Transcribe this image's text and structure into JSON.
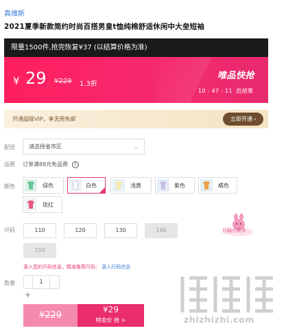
{
  "store_name": "真维斯",
  "product_title": "2021夏季新款简约时尚百搭男皇t恤纯棉舒适休闲中大垒短袖",
  "promo": {
    "limit_text": "限量1500件,抢完恢复¥37 (以结算价格为准)",
    "currency": "¥",
    "price": "29",
    "original_price": "¥229",
    "discount": "1.3折",
    "flash_label": "唯品快抢",
    "countdown_h": "10",
    "countdown_m": "47",
    "countdown_s": "11",
    "countdown_suffix": "后结束"
  },
  "vip": {
    "text": "开通超级VIP，享无限免邮",
    "button": "立即开通"
  },
  "delivery": {
    "label": "配送",
    "region_placeholder": "请选择省市区"
  },
  "shipping": {
    "label": "运费",
    "text": "订单满88元免运费",
    "help_icon": "?"
  },
  "colors": {
    "label": "颜色",
    "options": [
      {
        "label": "绿色",
        "selected": false
      },
      {
        "label": "白色",
        "selected": true
      },
      {
        "label": "浅黄",
        "selected": false
      },
      {
        "label": "紫色",
        "selected": false
      },
      {
        "label": "橘色",
        "selected": false
      },
      {
        "label": "玫红",
        "selected": false
      }
    ]
  },
  "sizes": {
    "label": "尺码",
    "options": [
      {
        "label": "110",
        "disabled": false
      },
      {
        "label": "120",
        "disabled": false
      },
      {
        "label": "130",
        "disabled": false
      },
      {
        "label": "140",
        "disabled": true
      },
      {
        "label": "150",
        "disabled": true
      }
    ],
    "helper": "尺码小帮手"
  },
  "size_note": {
    "text": "录入您的尺码信息，精准推荐尺码：",
    "link": "录入尺码信息"
  },
  "quantity": {
    "label": "数量",
    "minus": "-",
    "value": "1",
    "plus": "+"
  },
  "buy": {
    "original_price": "¥229",
    "sale_price": "¥29",
    "action": "特卖价 抢 >"
  },
  "watermark": "zhizhizhi.com",
  "accent_color": "#ea2d6b",
  "link_color": "#3d7bd6"
}
